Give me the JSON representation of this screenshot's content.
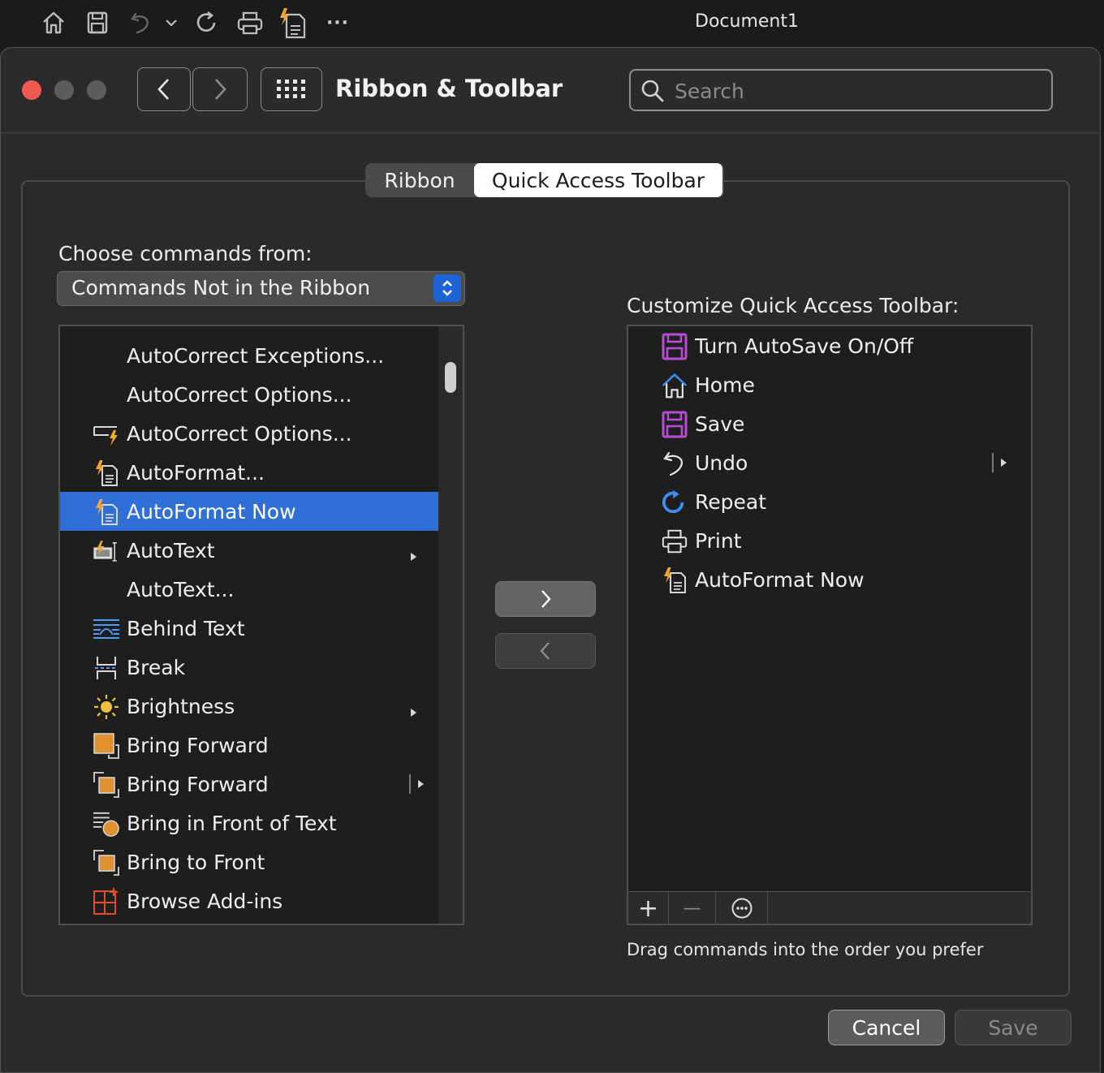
{
  "app_toolbar": {
    "icons": [
      "home-icon",
      "save-icon",
      "undo-icon",
      "undo-menu-chevron-icon",
      "repeat-icon",
      "print-icon",
      "autoformat-icon",
      "more-icon"
    ],
    "more_label": "···",
    "document_title": "Document1"
  },
  "window": {
    "title": "Ribbon & Toolbar",
    "search_placeholder": "Search"
  },
  "tabs": [
    {
      "label": "Ribbon",
      "active": false
    },
    {
      "label": "Quick Access Toolbar",
      "active": true
    }
  ],
  "left": {
    "label": "Choose commands from:",
    "source": "Commands Not in the Ribbon",
    "items": [
      {
        "label": "AutoCorrect Exceptions...",
        "icon": "none"
      },
      {
        "label": "AutoCorrect Options...",
        "icon": "none"
      },
      {
        "label": "AutoCorrect Options...",
        "icon": "autocorrect-options-icon"
      },
      {
        "label": "AutoFormat...",
        "icon": "autoformat-icon"
      },
      {
        "label": "AutoFormat Now",
        "icon": "autoformat-icon",
        "selected": true
      },
      {
        "label": "AutoText",
        "icon": "autotext-icon",
        "submenu": "arrow"
      },
      {
        "label": "AutoText...",
        "icon": "none"
      },
      {
        "label": "Behind Text",
        "icon": "behind-text-icon"
      },
      {
        "label": "Break",
        "icon": "break-icon"
      },
      {
        "label": "Brightness",
        "icon": "brightness-icon",
        "submenu": "arrow"
      },
      {
        "label": "Bring Forward",
        "icon": "bring-forward-icon"
      },
      {
        "label": "Bring Forward",
        "icon": "bring-forward-split-icon",
        "submenu": "split"
      },
      {
        "label": "Bring in Front of Text",
        "icon": "bring-in-front-of-text-icon"
      },
      {
        "label": "Bring to Front",
        "icon": "bring-to-front-icon"
      },
      {
        "label": "Browse Add-ins",
        "icon": "browse-add-ins-icon"
      }
    ]
  },
  "right": {
    "label": "Customize Quick Access Toolbar:",
    "items": [
      {
        "label": "Turn AutoSave On/Off",
        "icon": "autosave-icon"
      },
      {
        "label": "Home",
        "icon": "home-icon"
      },
      {
        "label": "Save",
        "icon": "save-icon"
      },
      {
        "label": "Undo",
        "icon": "undo-icon",
        "submenu": "split"
      },
      {
        "label": "Repeat",
        "icon": "repeat-icon"
      },
      {
        "label": "Print",
        "icon": "print-icon"
      },
      {
        "label": "AutoFormat Now",
        "icon": "autoformat-icon"
      }
    ],
    "add_label": "+",
    "remove_label": "—",
    "hint": "Drag commands into the order you prefer"
  },
  "buttons": {
    "cancel": "Cancel",
    "save": "Save"
  },
  "colors": {
    "selection": "#2f6fd6",
    "accent": "#1f63d8",
    "close": "#ee5a52",
    "qat_icon": "#b94cd6",
    "lightning": "#f0a830"
  }
}
